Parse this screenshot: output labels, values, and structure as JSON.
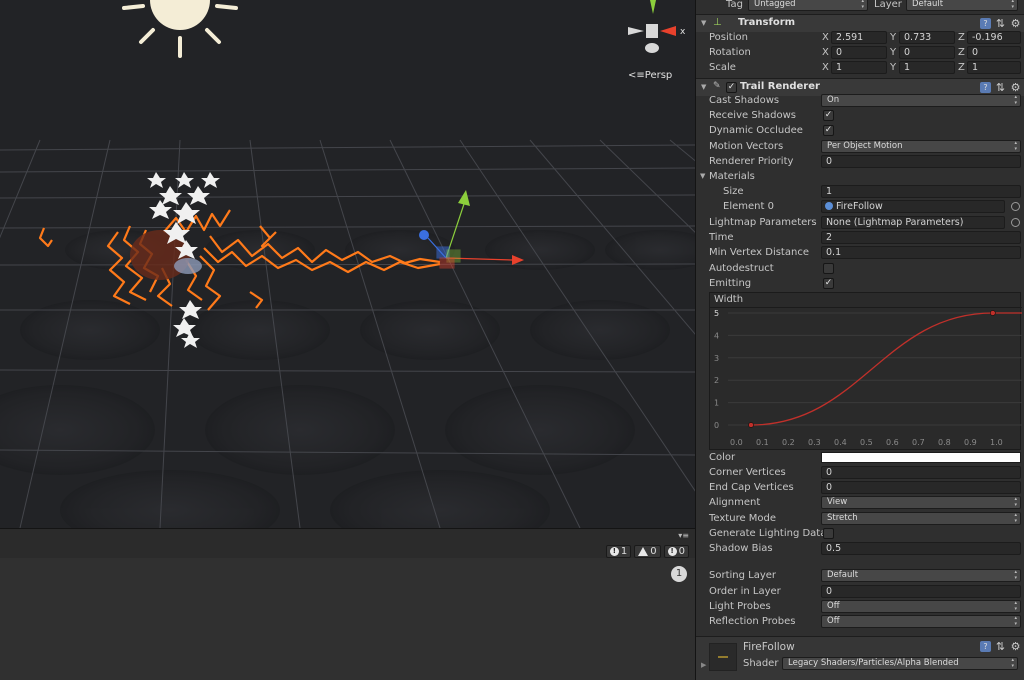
{
  "scene": {
    "persp_label": "Persp"
  },
  "console": {
    "counts": [
      {
        "icon": "info-icon",
        "value": "1"
      },
      {
        "icon": "warning-icon",
        "value": "0"
      },
      {
        "icon": "error-icon",
        "value": "0"
      }
    ],
    "badge": "1"
  },
  "inspector": {
    "tag_label": "Tag",
    "tag_value": "Untagged",
    "layer_label": "Layer",
    "layer_value": "Default",
    "transform": {
      "title": "Transform",
      "position": {
        "label": "Position",
        "x": "2.591",
        "y": "0.733",
        "z": "-0.196"
      },
      "rotation": {
        "label": "Rotation",
        "x": "0",
        "y": "0",
        "z": "0"
      },
      "scale": {
        "label": "Scale",
        "x": "1",
        "y": "1",
        "z": "1"
      },
      "axis_x": "X",
      "axis_y": "Y",
      "axis_z": "Z"
    },
    "trail": {
      "title": "Trail Renderer",
      "cast_shadows": {
        "label": "Cast Shadows",
        "value": "On"
      },
      "receive_shadows": {
        "label": "Receive Shadows",
        "checked": "✓"
      },
      "dynamic_occludee": {
        "label": "Dynamic Occludee",
        "checked": "✓"
      },
      "motion_vectors": {
        "label": "Motion Vectors",
        "value": "Per Object Motion"
      },
      "renderer_priority": {
        "label": "Renderer Priority",
        "value": "0"
      },
      "materials": {
        "label": "Materials"
      },
      "size": {
        "label": "Size",
        "value": "1"
      },
      "element0": {
        "label": "Element 0",
        "value": "FireFollow"
      },
      "lightmap_params": {
        "label": "Lightmap Parameters",
        "value": "None (Lightmap Parameters)"
      },
      "time": {
        "label": "Time",
        "value": "2"
      },
      "min_vertex": {
        "label": "Min Vertex Distance",
        "value": "0.1"
      },
      "autodestruct": {
        "label": "Autodestruct"
      },
      "emitting": {
        "label": "Emitting",
        "checked": "✓"
      },
      "width": {
        "label": "Width",
        "y_ticks": [
          "5",
          "4",
          "3",
          "2",
          "1",
          "0"
        ],
        "x_ticks": [
          "0.0",
          "0.1",
          "0.2",
          "0.3",
          "0.4",
          "0.5",
          "0.6",
          "0.7",
          "0.8",
          "0.9",
          "1.0"
        ],
        "start_point": {
          "x": 0.05,
          "y": 0
        },
        "end_point": {
          "x": 0.98,
          "y": 5
        }
      },
      "color": {
        "label": "Color",
        "value": "#ffffff"
      },
      "corner_vertices": {
        "label": "Corner Vertices",
        "value": "0"
      },
      "end_cap_vertices": {
        "label": "End Cap Vertices",
        "value": "0"
      },
      "alignment": {
        "label": "Alignment",
        "value": "View"
      },
      "texture_mode": {
        "label": "Texture Mode",
        "value": "Stretch"
      },
      "generate_lighting": {
        "label": "Generate Lighting Data"
      },
      "shadow_bias": {
        "label": "Shadow Bias",
        "value": "0.5"
      },
      "sorting_layer": {
        "label": "Sorting Layer",
        "value": "Default"
      },
      "order_in_layer": {
        "label": "Order in Layer",
        "value": "0"
      },
      "light_probes": {
        "label": "Light Probes",
        "value": "Off"
      },
      "reflection_probes": {
        "label": "Reflection Probes",
        "value": "Off"
      }
    },
    "material": {
      "name": "FireFollow",
      "shader_label": "Shader",
      "shader_value": "Legacy Shaders/Particles/Alpha Blended"
    }
  },
  "colors": {
    "trail_orange": "#ff7a1a",
    "curve_red": "#c0302a",
    "gizmo_x": "#e8412c",
    "gizmo_y": "#8ccf3c",
    "gizmo_z": "#3a6fe0"
  }
}
